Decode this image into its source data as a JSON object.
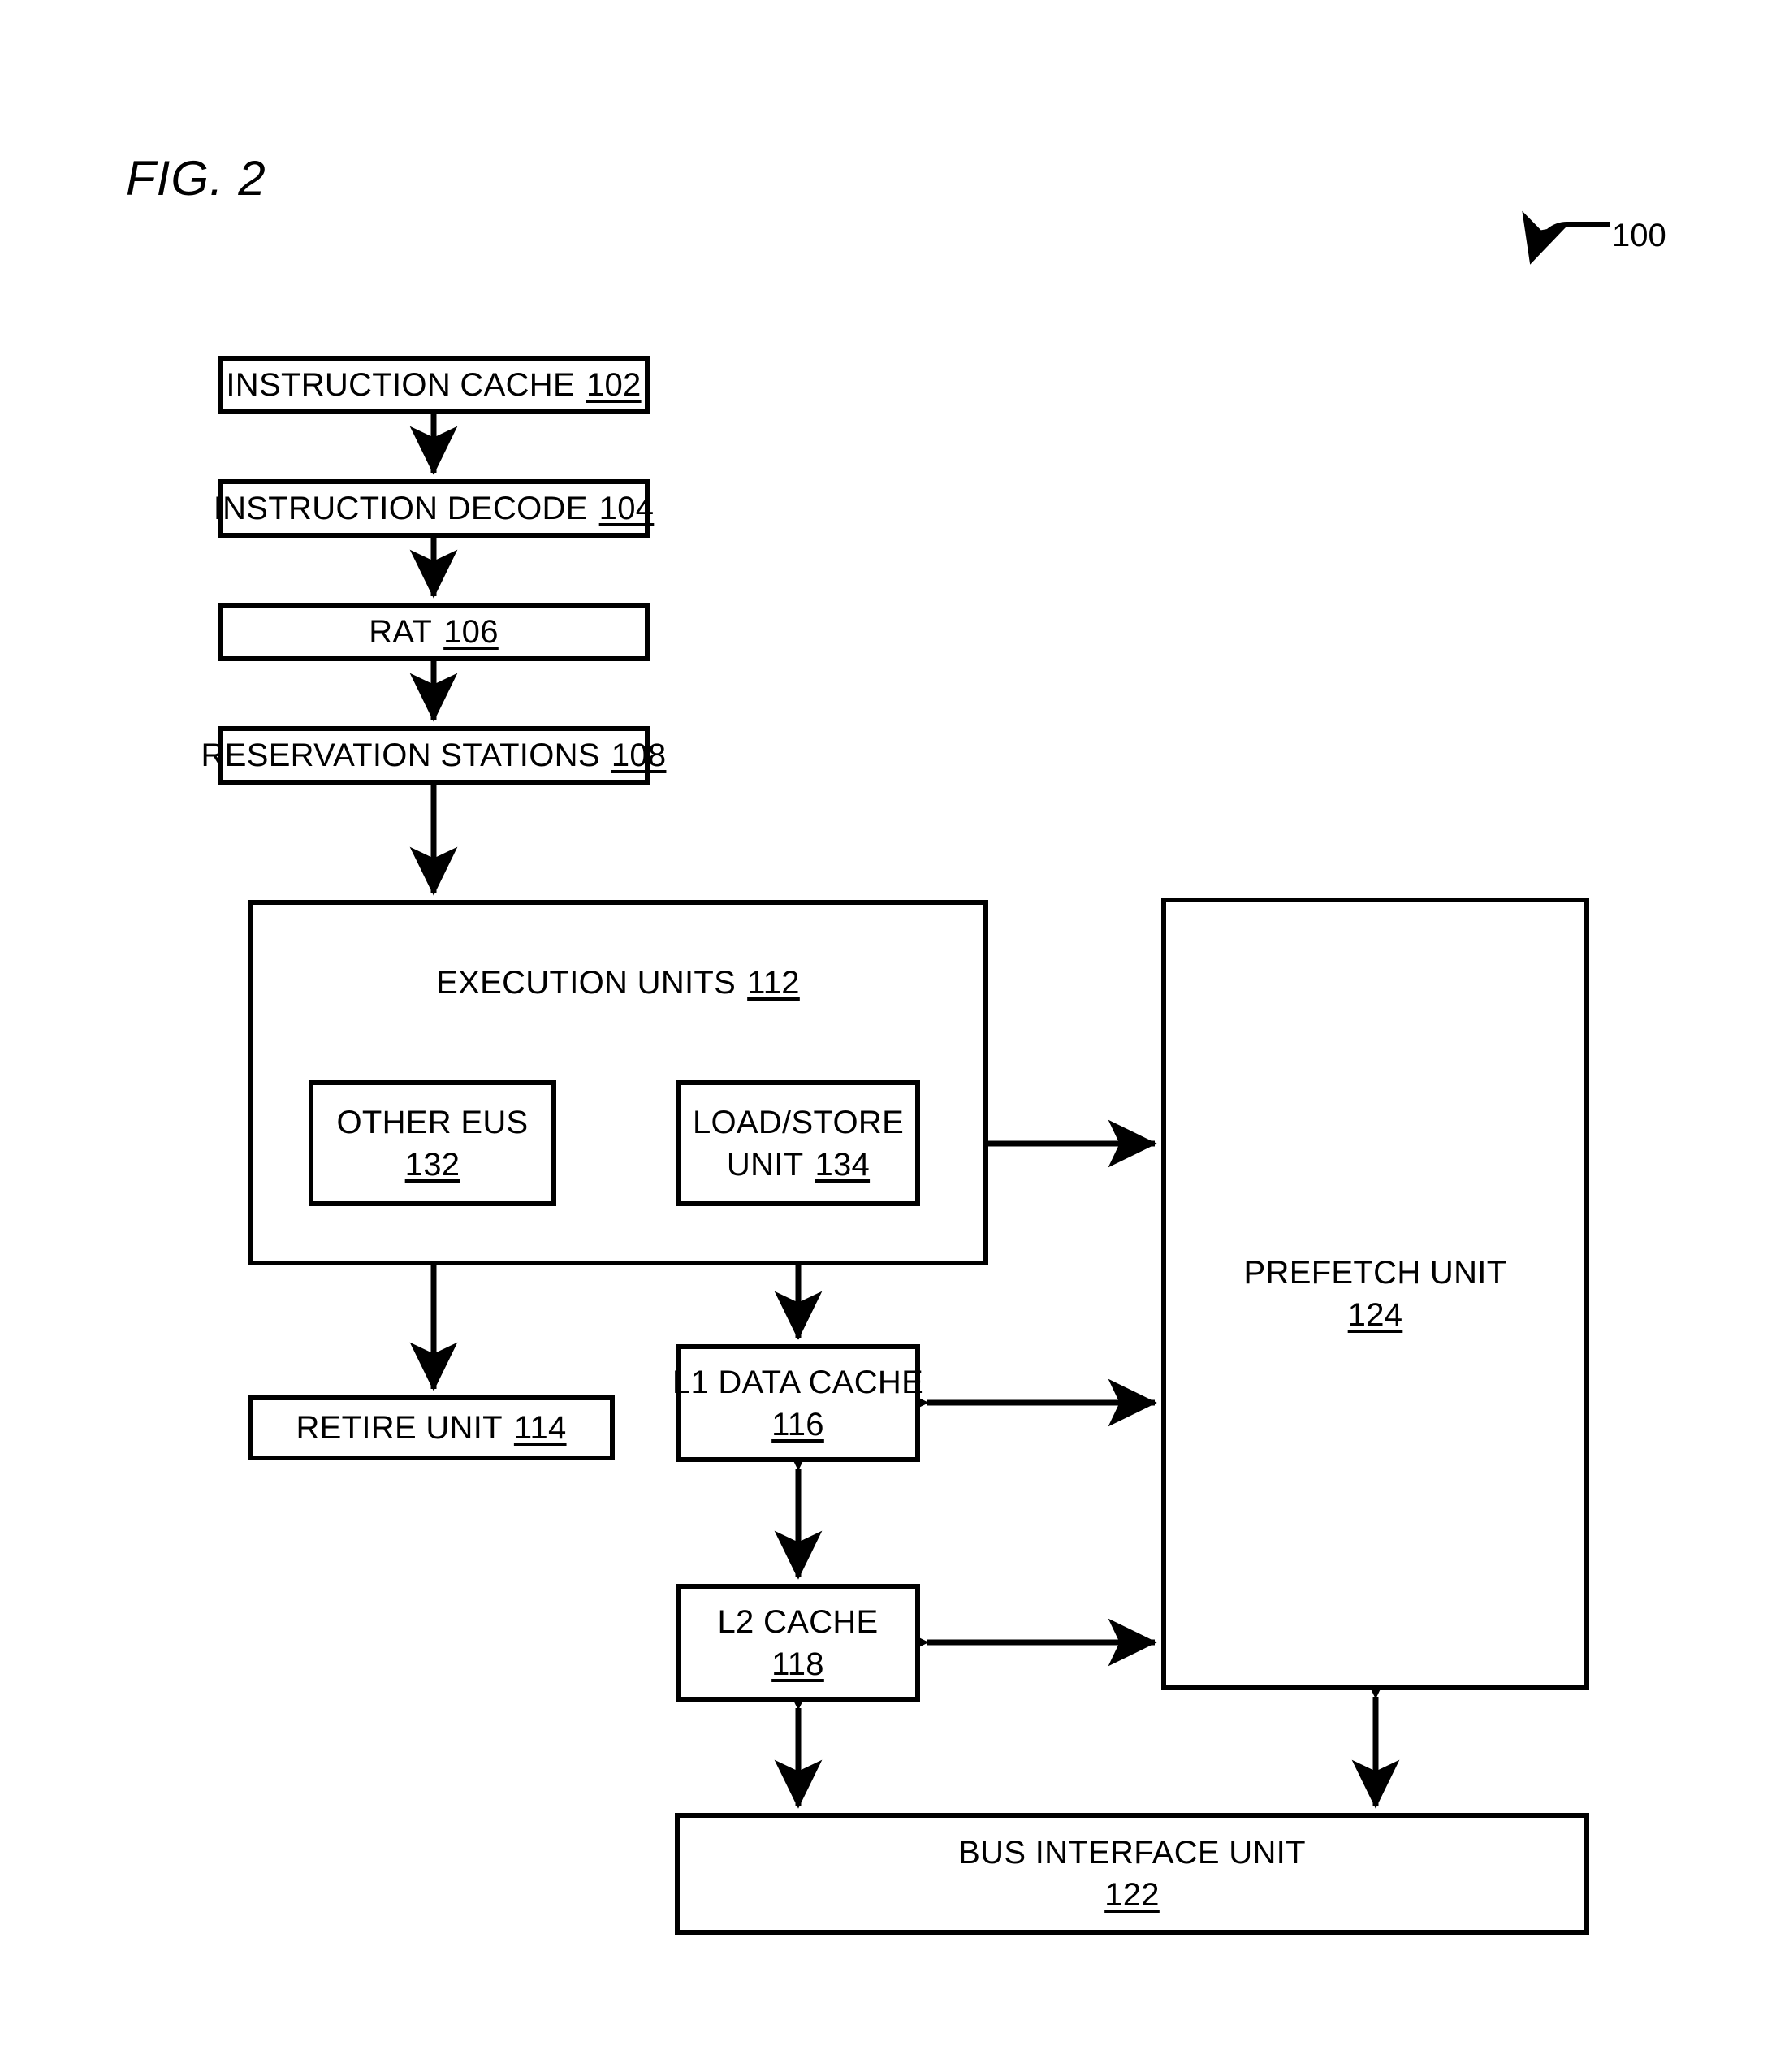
{
  "figure": {
    "label": "FIG. 2",
    "system_reference": "100"
  },
  "blocks": {
    "instruction_cache": {
      "title": "INSTRUCTION CACHE",
      "number": "102"
    },
    "instruction_decode": {
      "title": "INSTRUCTION DECODE",
      "number": "104"
    },
    "rat": {
      "title": "RAT",
      "number": "106"
    },
    "reservation_stations": {
      "title": "RESERVATION STATIONS",
      "number": "108"
    },
    "execution_units": {
      "title": "EXECUTION UNITS",
      "number": "112"
    },
    "other_eus": {
      "title": "OTHER EUS",
      "number": "132"
    },
    "load_store_unit": {
      "title_line1": "LOAD/STORE",
      "title_line2": "UNIT",
      "number": "134"
    },
    "retire_unit": {
      "title": "RETIRE UNIT",
      "number": "114"
    },
    "l1_data_cache": {
      "title": "L1 DATA CACHE",
      "number": "116"
    },
    "l2_cache": {
      "title": "L2 CACHE",
      "number": "118"
    },
    "prefetch_unit": {
      "title": "PREFETCH UNIT",
      "number": "124"
    },
    "bus_interface_unit": {
      "title": "BUS INTERFACE UNIT",
      "number": "122"
    }
  },
  "connections": [
    {
      "from": "instruction_cache",
      "to": "instruction_decode",
      "style": "arrow-down"
    },
    {
      "from": "instruction_decode",
      "to": "rat",
      "style": "arrow-down"
    },
    {
      "from": "rat",
      "to": "reservation_stations",
      "style": "arrow-down"
    },
    {
      "from": "reservation_stations",
      "to": "execution_units",
      "style": "arrow-down"
    },
    {
      "from": "execution_units",
      "to": "retire_unit",
      "style": "arrow-down"
    },
    {
      "from": "load_store_unit",
      "to": "prefetch_unit",
      "style": "bidirectional"
    },
    {
      "from": "load_store_unit",
      "to": "l1_data_cache",
      "style": "bidirectional"
    },
    {
      "from": "l1_data_cache",
      "to": "prefetch_unit",
      "style": "bidirectional"
    },
    {
      "from": "l1_data_cache",
      "to": "l2_cache",
      "style": "bidirectional"
    },
    {
      "from": "l2_cache",
      "to": "prefetch_unit",
      "style": "bidirectional"
    },
    {
      "from": "l2_cache",
      "to": "bus_interface_unit",
      "style": "bidirectional"
    },
    {
      "from": "prefetch_unit",
      "to": "bus_interface_unit",
      "style": "bidirectional"
    }
  ],
  "colors": {
    "line": "#000000",
    "background": "#ffffff"
  }
}
